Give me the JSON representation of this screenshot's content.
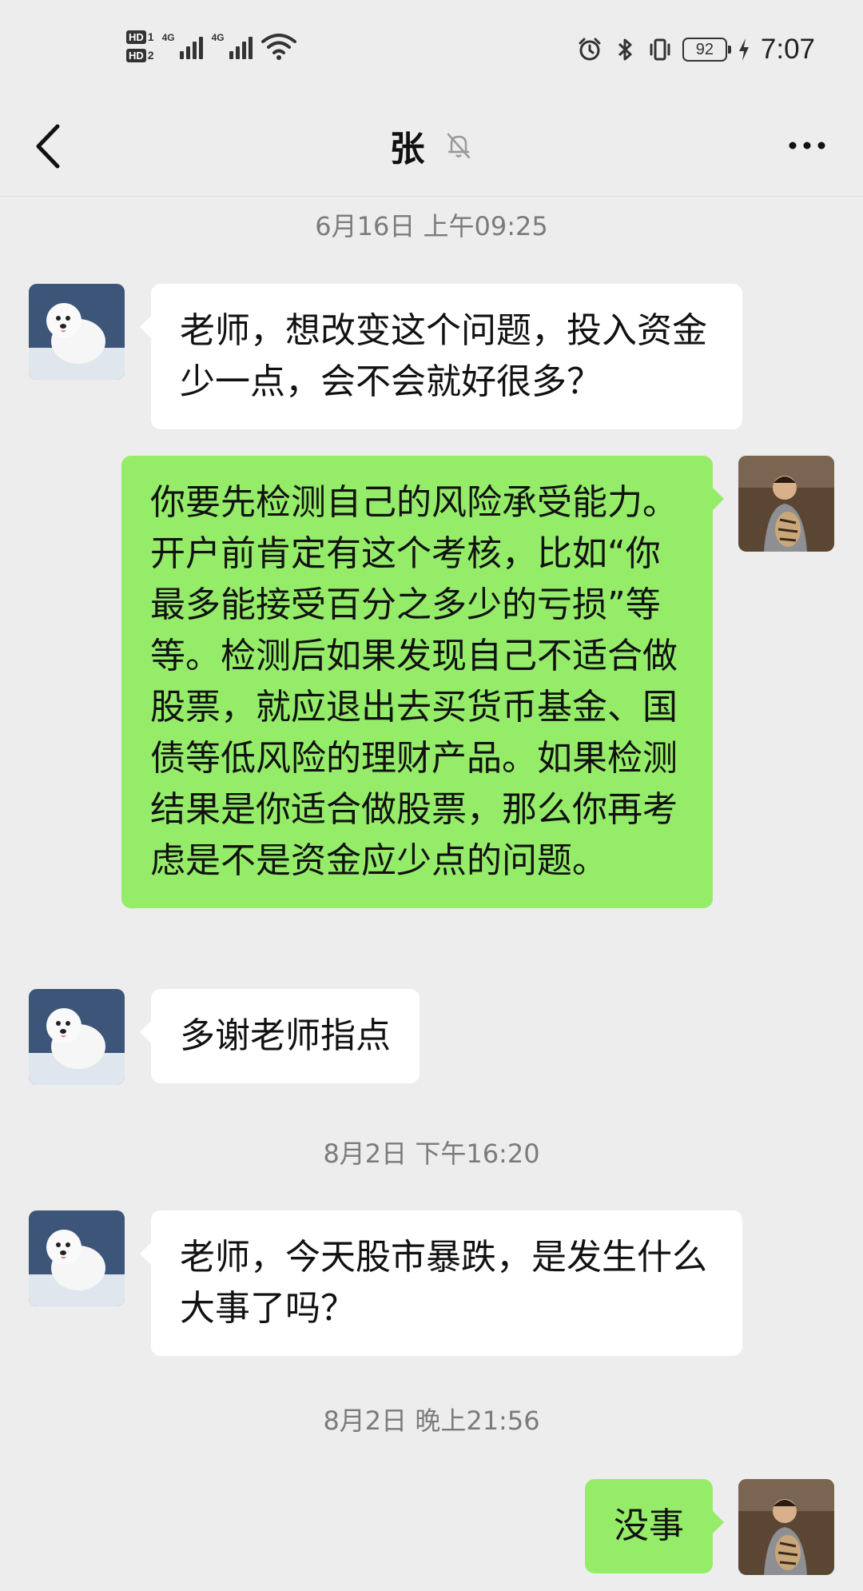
{
  "status_bar": {
    "sim1_tag": "HD",
    "sim1_num": "1",
    "sim2_tag": "HD",
    "sim2_num": "2",
    "network1": "4G",
    "network2": "4G",
    "battery": "92",
    "time": "7:07",
    "icons": [
      "alarm-icon",
      "bluetooth-icon",
      "vibrate-icon",
      "battery-icon",
      "charging-icon",
      "wifi-icon",
      "signal-icon"
    ]
  },
  "header": {
    "title": "张",
    "icons": [
      "back-arrow-icon",
      "mute-bell-icon",
      "more-dots-icon"
    ]
  },
  "chat": {
    "timestamps": [
      "6月16日 上午09:25",
      "8月2日 下午16:20",
      "8月2日 晚上21:56"
    ],
    "messages": [
      {
        "from": "contact",
        "text": "老师，想改变这个问题，投入资金少一点，会不会就好很多？"
      },
      {
        "from": "me",
        "text": "你要先检测自己的风险承受能力。开户前肯定有这个考核，比如“你最多能接受百分之多少的亏损”等等。检测后如果发现自己不适合做股票，就应退出去买货币基金、国债等低风险的理财产品。如果检测结果是你适合做股票，那么你再考虑是不是资金应少点的问题。"
      },
      {
        "from": "contact",
        "text": "多谢老师指点"
      },
      {
        "from": "contact",
        "text": "老师，今天股市暴跌，是发生什么大事了吗？"
      },
      {
        "from": "me",
        "text": "没事"
      }
    ]
  },
  "colors": {
    "background": "#ededed",
    "outgoing_bubble": "#95ec69",
    "incoming_bubble": "#ffffff",
    "timestamp_text": "#7b7b7b"
  }
}
